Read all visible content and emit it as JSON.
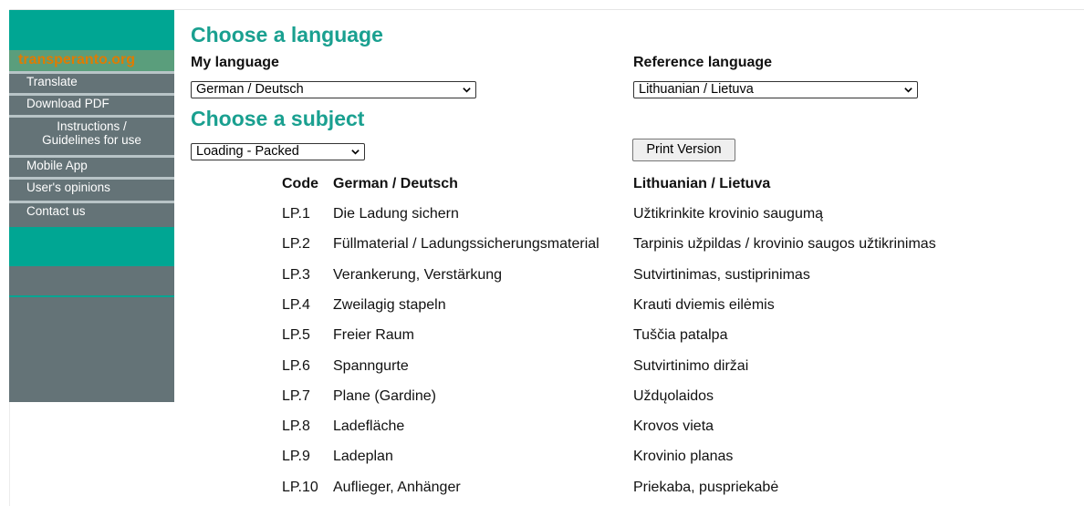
{
  "sidebar": {
    "brand": "transperanto.org",
    "items": [
      {
        "label": "Translate"
      },
      {
        "label": "Download PDF"
      },
      {
        "label": "Instructions / Guidelines for use",
        "line1": "Instructions /",
        "line2": "Guidelines for use"
      },
      {
        "label": "Mobile App"
      },
      {
        "label": "User's opinions"
      },
      {
        "label": "Contact us"
      }
    ]
  },
  "main": {
    "choose_language_heading": "Choose a language",
    "my_language_label": "My language",
    "my_language_value": "German / Deutsch",
    "reference_language_label": "Reference language",
    "reference_language_value": "Lithuanian / Lietuva",
    "choose_subject_heading": "Choose a subject",
    "subject_value": "Loading - Packed",
    "print_button": "Print Version"
  },
  "table": {
    "headers": {
      "code": "Code",
      "lang1": "German / Deutsch",
      "lang2": "Lithuanian / Lietuva"
    },
    "rows": [
      {
        "code": "LP.1",
        "de": "Die Ladung sichern",
        "lt": "Užtikrinkite krovinio saugumą"
      },
      {
        "code": "LP.2",
        "de": "Füllmaterial / Ladungssicherungsmaterial",
        "lt": "Tarpinis užpildas / krovinio saugos užtikrinimas"
      },
      {
        "code": "LP.3",
        "de": "Verankerung, Verstärkung",
        "lt": "Sutvirtinimas, sustiprinimas"
      },
      {
        "code": "LP.4",
        "de": "Zweilagig stapeln",
        "lt": "Krauti dviemis eilėmis"
      },
      {
        "code": "LP.5",
        "de": "Freier Raum",
        "lt": "Tuščia patalpa"
      },
      {
        "code": "LP.6",
        "de": "Spanngurte",
        "lt": "Sutvirtinimo diržai"
      },
      {
        "code": "LP.7",
        "de": "Plane (Gardine)",
        "lt": "Uždųolaidos"
      },
      {
        "code": "LP.8",
        "de": "Ladefläche",
        "lt": "Krovos vieta"
      },
      {
        "code": "LP.9",
        "de": "Ladeplan",
        "lt": "Krovinio planas"
      },
      {
        "code": "LP.10",
        "de": "Auflieger, Anhänger",
        "lt": "Priekaba, puspriekabė"
      }
    ]
  },
  "colors": {
    "teal": "#00a693",
    "heading": "#1aa090",
    "brand": "#e07b00",
    "sidebar_bg": "#647377"
  }
}
